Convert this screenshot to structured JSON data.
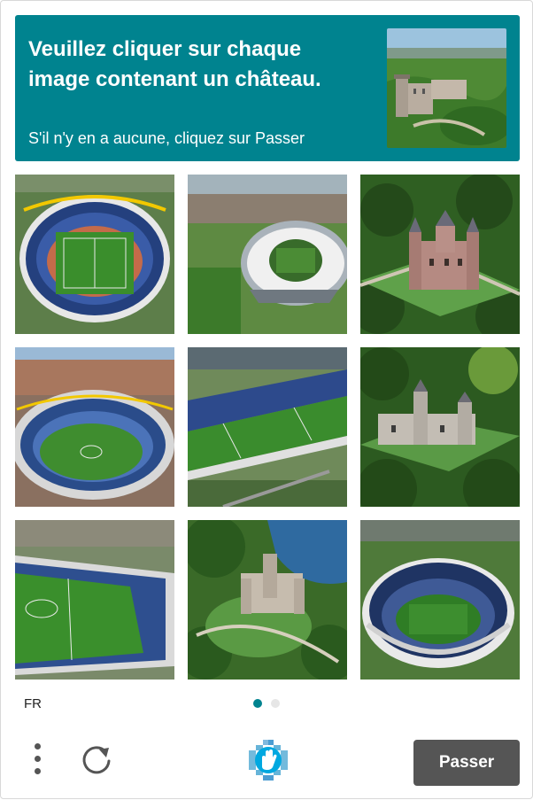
{
  "header": {
    "prompt": "Veuillez cliquer sur chaque image contenant un château.",
    "instruction": "S'il n'y en a aucune, cliquez sur Passer",
    "example_image": "castle-example",
    "background_color": "#00838f"
  },
  "tiles": [
    {
      "subject": "stadium"
    },
    {
      "subject": "stadium"
    },
    {
      "subject": "castle"
    },
    {
      "subject": "stadium"
    },
    {
      "subject": "stadium"
    },
    {
      "subject": "castle"
    },
    {
      "subject": "stadium"
    },
    {
      "subject": "castle"
    },
    {
      "subject": "stadium"
    }
  ],
  "footer": {
    "language": "FR",
    "pages": 2,
    "current_page": 1
  },
  "toolbar": {
    "menu_icon": "kebab-menu-icon",
    "refresh_icon": "refresh-icon",
    "logo_icon": "hcaptcha-hand-logo",
    "skip_label": "Passer",
    "skip_color": "#555555"
  }
}
